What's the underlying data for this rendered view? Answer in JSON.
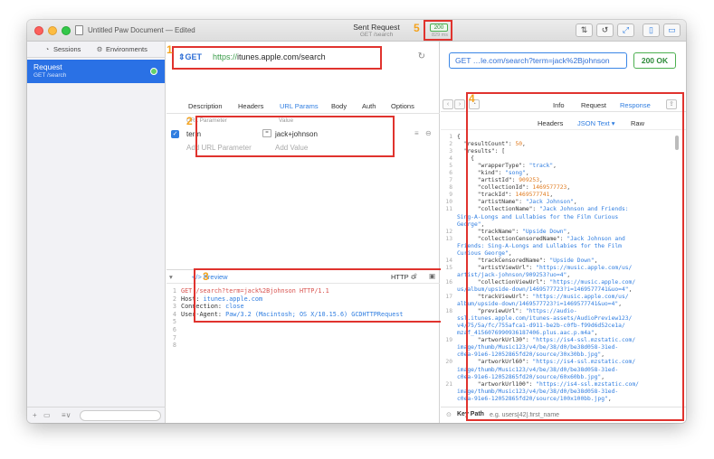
{
  "titlebar": {
    "document_title": "Untitled Paw Document — Edited",
    "sent_title": "Sent Request",
    "sent_subtitle": "GET /search",
    "status_code": "200",
    "status_time": "829 ms"
  },
  "sidebar": {
    "tabs": {
      "sessions": "Sessions",
      "environments": "Environments"
    },
    "selected_request": {
      "name": "Request",
      "subtitle": "GET /search"
    },
    "bottom": {
      "add": "+",
      "funnel": "≡∨"
    }
  },
  "request": {
    "method": "GET",
    "url_scheme": "https://",
    "url_host": "itunes.apple.com/search",
    "tabs": [
      "Description",
      "Headers",
      "URL Params",
      "Body",
      "Auth",
      "Options"
    ],
    "params_header": {
      "name": "URL Parameter",
      "value": "Value"
    },
    "params": [
      {
        "name": "term",
        "value": "jack+johnson"
      }
    ],
    "add_param_placeholder": "Add URL Parameter",
    "add_value_placeholder": "Add Value"
  },
  "preview": {
    "tab_label": "</> Preview",
    "format": "HTTP ≎",
    "lines": [
      {
        "n": "1",
        "parts": [
          {
            "t": "GET /search?term=jack%2Bjohnson HTTP/1.1",
            "c": "red"
          }
        ]
      },
      {
        "n": "2",
        "parts": [
          {
            "t": "Host: ",
            "c": "dark"
          },
          {
            "t": "itunes.apple.com",
            "c": "blue"
          }
        ]
      },
      {
        "n": "3",
        "parts": [
          {
            "t": "Connection: ",
            "c": "dark"
          },
          {
            "t": "close",
            "c": "blue"
          }
        ]
      },
      {
        "n": "4",
        "parts": [
          {
            "t": "User-Agent: ",
            "c": "dark"
          },
          {
            "t": "Paw/3.2 (Macintosh; OS X/10.15.6) GCDHTTPRequest",
            "c": "blue"
          }
        ]
      },
      {
        "n": "5",
        "parts": []
      },
      {
        "n": "6",
        "parts": []
      },
      {
        "n": "7",
        "parts": []
      },
      {
        "n": "8",
        "parts": []
      }
    ]
  },
  "response": {
    "url_display": "GET …le.com/search?term=jack%2Bjohnson",
    "status": "200 OK",
    "nav_tabs": [
      "Info",
      "Request",
      "Response"
    ],
    "body_tabs": [
      "Headers",
      "JSON Text ▾",
      "Raw"
    ],
    "keypath_label": "Key Path",
    "keypath_placeholder": "e.g. users[42].first_name",
    "json_lines": [
      {
        "n": "1",
        "parts": [
          {
            "t": "{",
            "c": "key"
          }
        ]
      },
      {
        "n": "2",
        "parts": [
          {
            "t": "  \"resultCount\": ",
            "c": "key"
          },
          {
            "t": "50",
            "c": "num"
          },
          {
            "t": ",",
            "c": "key"
          }
        ]
      },
      {
        "n": "3",
        "parts": [
          {
            "t": "  \"results\": [",
            "c": "key"
          }
        ]
      },
      {
        "n": "4",
        "parts": [
          {
            "t": "    {",
            "c": "key"
          }
        ]
      },
      {
        "n": "5",
        "parts": [
          {
            "t": "      \"wrapperType\": ",
            "c": "key"
          },
          {
            "t": "\"track\"",
            "c": "str"
          },
          {
            "t": ",",
            "c": "key"
          }
        ]
      },
      {
        "n": "6",
        "parts": [
          {
            "t": "      \"kind\": ",
            "c": "key"
          },
          {
            "t": "\"song\"",
            "c": "str"
          },
          {
            "t": ",",
            "c": "key"
          }
        ]
      },
      {
        "n": "7",
        "parts": [
          {
            "t": "      \"artistId\": ",
            "c": "key"
          },
          {
            "t": "909253",
            "c": "num"
          },
          {
            "t": ",",
            "c": "key"
          }
        ]
      },
      {
        "n": "8",
        "parts": [
          {
            "t": "      \"collectionId\": ",
            "c": "key"
          },
          {
            "t": "1469577723",
            "c": "num"
          },
          {
            "t": ",",
            "c": "key"
          }
        ]
      },
      {
        "n": "9",
        "parts": [
          {
            "t": "      \"trackId\": ",
            "c": "key"
          },
          {
            "t": "1469577741",
            "c": "num"
          },
          {
            "t": ",",
            "c": "key"
          }
        ]
      },
      {
        "n": "10",
        "parts": [
          {
            "t": "      \"artistName\": ",
            "c": "key"
          },
          {
            "t": "\"Jack Johnson\"",
            "c": "str"
          },
          {
            "t": ",",
            "c": "key"
          }
        ]
      },
      {
        "n": "11",
        "parts": [
          {
            "t": "      \"collectionName\": ",
            "c": "key"
          },
          {
            "t": "\"Jack Johnson and Friends:",
            "c": "str"
          }
        ]
      },
      {
        "n": "",
        "parts": [
          {
            "t": "Sing-A-Longs and Lullabies for the Film Curious",
            "c": "str"
          }
        ]
      },
      {
        "n": "",
        "parts": [
          {
            "t": "George\"",
            "c": "str"
          },
          {
            "t": ",",
            "c": "key"
          }
        ]
      },
      {
        "n": "12",
        "parts": [
          {
            "t": "      \"trackName\": ",
            "c": "key"
          },
          {
            "t": "\"Upside Down\"",
            "c": "str"
          },
          {
            "t": ",",
            "c": "key"
          }
        ]
      },
      {
        "n": "13",
        "parts": [
          {
            "t": "      \"collectionCensoredName\": ",
            "c": "key"
          },
          {
            "t": "\"Jack Johnson and",
            "c": "str"
          }
        ]
      },
      {
        "n": "",
        "parts": [
          {
            "t": "Friends: Sing-A-Longs and Lullabies for the Film",
            "c": "str"
          }
        ]
      },
      {
        "n": "",
        "parts": [
          {
            "t": "Curious George\"",
            "c": "str"
          },
          {
            "t": ",",
            "c": "key"
          }
        ]
      },
      {
        "n": "14",
        "parts": [
          {
            "t": "      \"trackCensoredName\": ",
            "c": "key"
          },
          {
            "t": "\"Upside Down\"",
            "c": "str"
          },
          {
            "t": ",",
            "c": "key"
          }
        ]
      },
      {
        "n": "15",
        "parts": [
          {
            "t": "      \"artistViewUrl\": ",
            "c": "key"
          },
          {
            "t": "\"https://music.apple.com/us/",
            "c": "str"
          }
        ]
      },
      {
        "n": "",
        "parts": [
          {
            "t": "artist/jack-johnson/909253?uo=4\"",
            "c": "str"
          },
          {
            "t": ",",
            "c": "key"
          }
        ]
      },
      {
        "n": "16",
        "parts": [
          {
            "t": "      \"collectionViewUrl\": ",
            "c": "key"
          },
          {
            "t": "\"https://music.apple.com/",
            "c": "str"
          }
        ]
      },
      {
        "n": "",
        "parts": [
          {
            "t": "us/album/upside-down/1469577723?i=1469577741&uo=4\"",
            "c": "str"
          },
          {
            "t": ",",
            "c": "key"
          }
        ]
      },
      {
        "n": "17",
        "parts": [
          {
            "t": "      \"trackViewUrl\": ",
            "c": "key"
          },
          {
            "t": "\"https://music.apple.com/us/",
            "c": "str"
          }
        ]
      },
      {
        "n": "",
        "parts": [
          {
            "t": "album/upside-down/1469577723?i=1469577741&uo=4\"",
            "c": "str"
          },
          {
            "t": ",",
            "c": "key"
          }
        ]
      },
      {
        "n": "18",
        "parts": [
          {
            "t": "      \"previewUrl\": ",
            "c": "key"
          },
          {
            "t": "\"https://audio-",
            "c": "str"
          }
        ]
      },
      {
        "n": "",
        "parts": [
          {
            "t": "ssl.itunes.apple.com/itunes-assets/AudioPreview123/",
            "c": "str"
          }
        ]
      },
      {
        "n": "",
        "parts": [
          {
            "t": "v4/75/5a/fc/755afca1-d911-be2b-c0fb-f99d6d52ce1a/",
            "c": "str"
          }
        ]
      },
      {
        "n": "",
        "parts": [
          {
            "t": "mzaf_4156076990936187406.plus.aac.p.m4a\"",
            "c": "str"
          },
          {
            "t": ",",
            "c": "key"
          }
        ]
      },
      {
        "n": "19",
        "parts": [
          {
            "t": "      \"artworkUrl30\": ",
            "c": "key"
          },
          {
            "t": "\"https://is4-ssl.mzstatic.com/",
            "c": "str"
          }
        ]
      },
      {
        "n": "",
        "parts": [
          {
            "t": "image/thumb/Music123/v4/be/38/d0/be38d058-31ed-",
            "c": "str"
          }
        ]
      },
      {
        "n": "",
        "parts": [
          {
            "t": "c0ea-91e6-12052865fd20/source/30x30bb.jpg\"",
            "c": "str"
          },
          {
            "t": ",",
            "c": "key"
          }
        ]
      },
      {
        "n": "20",
        "parts": [
          {
            "t": "      \"artworkUrl60\": ",
            "c": "key"
          },
          {
            "t": "\"https://is4-ssl.mzstatic.com/",
            "c": "str"
          }
        ]
      },
      {
        "n": "",
        "parts": [
          {
            "t": "image/thumb/Music123/v4/be/38/d0/be38d058-31ed-",
            "c": "str"
          }
        ]
      },
      {
        "n": "",
        "parts": [
          {
            "t": "c0ea-91e6-12052865fd20/source/60x60bb.jpg\"",
            "c": "str"
          },
          {
            "t": ",",
            "c": "key"
          }
        ]
      },
      {
        "n": "21",
        "parts": [
          {
            "t": "      \"artworkUrl100\": ",
            "c": "key"
          },
          {
            "t": "\"https://is4-ssl.mzstatic.com/",
            "c": "str"
          }
        ]
      },
      {
        "n": "",
        "parts": [
          {
            "t": "image/thumb/Music123/v4/be/38/d0/be38d058-31ed-",
            "c": "str"
          }
        ]
      },
      {
        "n": "",
        "parts": [
          {
            "t": "c0ea-91e6-12052865fd20/source/100x100bb.jpg\"",
            "c": "str"
          },
          {
            "t": ",",
            "c": "key"
          }
        ]
      }
    ]
  },
  "annotations": [
    "1",
    "2",
    "3",
    "4",
    "5"
  ],
  "colors": {
    "accent": "#2f7de0",
    "highlight_box": "#e0332e",
    "annotation_number": "#f4a21c",
    "status_ok": "#4caf50"
  }
}
